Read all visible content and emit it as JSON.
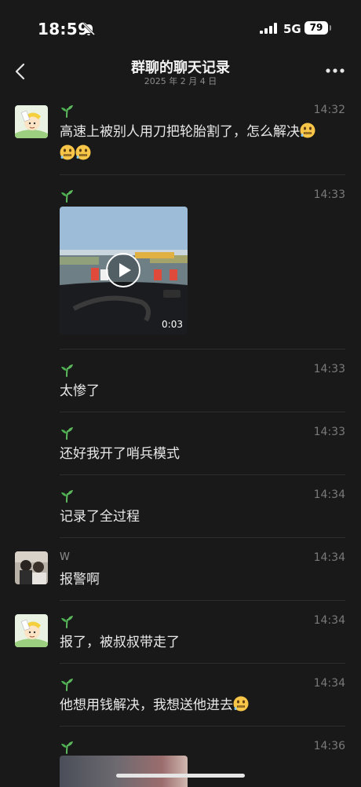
{
  "status_bar": {
    "time": "18:59",
    "network": "5G",
    "battery": "79"
  },
  "nav": {
    "title": "群聊的聊天记录",
    "subtitle": "2025 年 2 月 4 日"
  },
  "messages": [
    {
      "sender": "",
      "time": "14:32",
      "text": "高速上被别人用刀把轮胎割了，怎么解决"
    },
    {
      "sender": "",
      "time": "14:33",
      "video_duration": "0:03"
    },
    {
      "sender": "",
      "time": "14:33",
      "text": "太惨了"
    },
    {
      "sender": "",
      "time": "14:33",
      "text": "还好我开了哨兵模式"
    },
    {
      "sender": "",
      "time": "14:34",
      "text": "记录了全过程"
    },
    {
      "sender": "W",
      "time": "14:34",
      "text": "报警啊"
    },
    {
      "sender": "",
      "time": "14:34",
      "text": "报了，被叔叔带走了"
    },
    {
      "sender": "",
      "time": "14:34",
      "text": "他想用钱解决，我想送他进去"
    },
    {
      "sender": "",
      "time": "14:36"
    }
  ],
  "colors": {
    "background": "#191919",
    "text": "#e8e8e8",
    "secondary": "#7a7a7a",
    "sprout": "#4caf50"
  },
  "icons": {
    "back": "chevron-left-icon",
    "more": "more-dots-icon",
    "sender_badge": "sprout-icon",
    "emoji": "zipper-mouth-face"
  }
}
